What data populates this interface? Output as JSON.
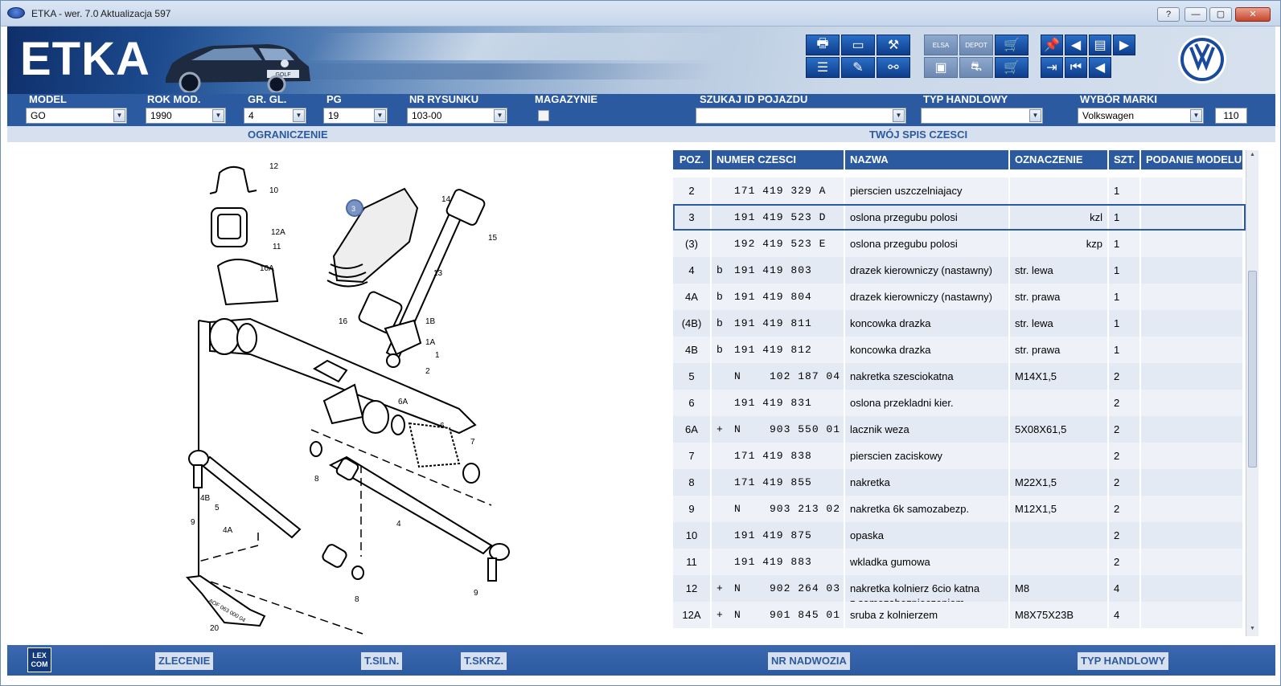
{
  "window": {
    "title": "ETKA - wer. 7.0 Aktualizacja 597",
    "help_label": "?",
    "min_label": "—",
    "max_label": "▢",
    "close_label": "✕"
  },
  "banner": {
    "logo_text": "ETKA",
    "car_plate": "GOLF",
    "brand_icon": "vw-logo-icon"
  },
  "toolbar": {
    "group1": [
      "print-icon",
      "screen-icon",
      "tools-icon",
      "printer-list-icon",
      "pencil-icon",
      "link-icon"
    ],
    "group2": [
      "elsa-icon",
      "depot-icon",
      "cart-add-icon",
      "monitor-icon",
      "car-search-icon",
      "cart-icon"
    ],
    "group3": [
      "pin-icon",
      "page-first-icon",
      "document-icon",
      "page-next-icon",
      "exit-icon",
      "page-first-alt-icon",
      "page-prev-icon"
    ],
    "elsa_label": "ELSA",
    "depot_label": "DEPOT"
  },
  "filters": {
    "model": {
      "label": "MODEL",
      "value": "GO"
    },
    "year": {
      "label": "ROK MOD.",
      "value": "1990"
    },
    "main_group": {
      "label": "GR. GL.",
      "value": "4"
    },
    "pg": {
      "label": "PG",
      "value": "19"
    },
    "drawing_no": {
      "label": "NR RYSUNKU",
      "value": "103-00"
    },
    "warehouse": {
      "label": "MAGAZYNIE"
    },
    "vehicle_id": {
      "label": "SZUKAJ ID POJAZDU",
      "value": ""
    },
    "trade_type": {
      "label": "TYP HANDLOWY",
      "value": ""
    },
    "brand": {
      "label": "WYBÓR MARKI",
      "value": "Volkswagen"
    },
    "brand_code": "110"
  },
  "subbar": {
    "restriction": "OGRANICZENIE",
    "parts_list": "TWÓJ SPIS CZESCI"
  },
  "table": {
    "headers": [
      "POZ.",
      "NUMER CZESCI",
      "NAZWA",
      "OZNACZENIE",
      "SZT.",
      "PODANIE MODELU"
    ],
    "rows": [
      {
        "poz": "2",
        "pre": "",
        "num": "171 419 329 A",
        "name": "pierscien uszczelniajacy",
        "mark": "",
        "qty": "1",
        "model": ""
      },
      {
        "poz": "3",
        "pre": "",
        "num": "191 419 523 D",
        "name": "oslona przegubu polosi",
        "mark": "kzl",
        "qty": "1",
        "model": ""
      },
      {
        "poz": "(3)",
        "pre": "",
        "num": "192 419 523 E",
        "name": "oslona przegubu polosi",
        "mark": "kzp",
        "qty": "1",
        "model": ""
      },
      {
        "poz": "4",
        "pre": "b",
        "num": "191 419 803",
        "name": "drazek kierowniczy (nastawny)",
        "mark": "str. lewa",
        "qty": "1",
        "model": ""
      },
      {
        "poz": "4A",
        "pre": "b",
        "num": "191 419 804",
        "name": "drazek kierowniczy (nastawny)",
        "mark": "str. prawa",
        "qty": "1",
        "model": ""
      },
      {
        "poz": "(4B)",
        "pre": "b",
        "num": "191 419 811",
        "name": "koncowka drazka",
        "mark": "str. lewa",
        "qty": "1",
        "model": ""
      },
      {
        "poz": "4B",
        "pre": "b",
        "num": "191 419 812",
        "name": "koncowka drazka",
        "mark": "str. prawa",
        "qty": "1",
        "model": ""
      },
      {
        "poz": "5",
        "pre": "",
        "num": "N    102 187 04",
        "name": "nakretka szesciokatna",
        "mark": "M14X1,5",
        "qty": "2",
        "model": ""
      },
      {
        "poz": "6",
        "pre": "",
        "num": "191 419 831",
        "name": "oslona przekladni kier.",
        "mark": "",
        "qty": "2",
        "model": ""
      },
      {
        "poz": "6A",
        "pre": "+",
        "num": "N    903 550 01",
        "name": "lacznik weza",
        "mark": "5X08X61,5",
        "qty": "2",
        "model": ""
      },
      {
        "poz": "7",
        "pre": "",
        "num": "171 419 838",
        "name": "pierscien zaciskowy",
        "mark": "",
        "qty": "2",
        "model": ""
      },
      {
        "poz": "8",
        "pre": "",
        "num": "171 419 855",
        "name": "nakretka",
        "mark": "M22X1,5",
        "qty": "2",
        "model": ""
      },
      {
        "poz": "9",
        "pre": "",
        "num": "N    903 213 02",
        "name": "nakretka 6k samozabezp.",
        "mark": "M12X1,5",
        "qty": "2",
        "model": ""
      },
      {
        "poz": "10",
        "pre": "",
        "num": "191 419 875",
        "name": "opaska",
        "mark": "",
        "qty": "2",
        "model": ""
      },
      {
        "poz": "11",
        "pre": "",
        "num": "191 419 883",
        "name": "wkladka gumowa",
        "mark": "",
        "qty": "2",
        "model": ""
      },
      {
        "poz": "12",
        "pre": "+",
        "num": "N    902 264 03",
        "name": "nakretka kolnierz 6cio katna",
        "name2": "z samozabezpieczeniem",
        "mark": "M8",
        "qty": "4",
        "model": ""
      },
      {
        "poz": "12A",
        "pre": "+",
        "num": "N    901 845 01",
        "name": "sruba z kolnierzem",
        "mark": "M8X75X23B",
        "qty": "4",
        "model": ""
      }
    ]
  },
  "drawing": {
    "callouts": [
      "12",
      "10",
      "12A",
      "11",
      "10A",
      "3",
      "14",
      "15",
      "13",
      "16",
      "1B",
      "1A",
      "1",
      "2",
      "6A",
      "6",
      "7",
      "8",
      "5",
      "4B",
      "4A",
      "9",
      "4",
      "8",
      "9",
      "20"
    ],
    "tube_text": "AOF 063 000 04"
  },
  "footer": {
    "lexcom": "LEX COM",
    "order": "ZLECENIE",
    "engine": "T.SILN.",
    "gearbox": "T.SKRZ.",
    "body_no": "NR NADWOZIA",
    "trade_type": "TYP HANDLOWY"
  }
}
